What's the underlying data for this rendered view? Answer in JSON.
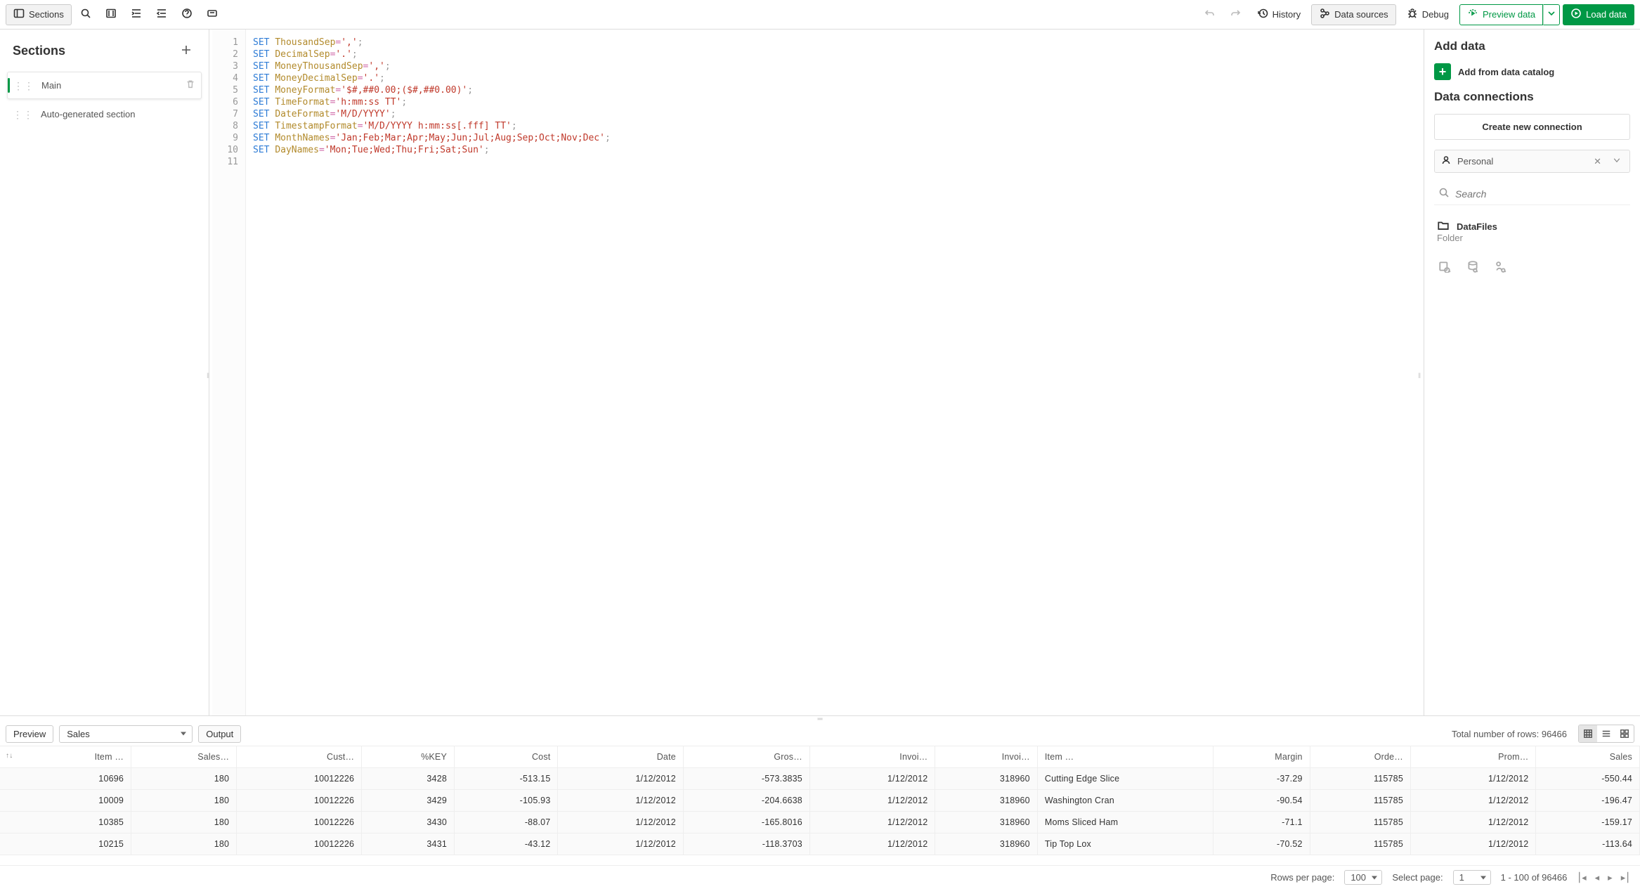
{
  "toolbar": {
    "sections": "Sections",
    "history": "History",
    "dataSources": "Data sources",
    "debug": "Debug",
    "preview": "Preview data",
    "load": "Load data"
  },
  "sidebar": {
    "title": "Sections",
    "items": [
      {
        "label": "Main"
      },
      {
        "label": "Auto-generated section"
      }
    ]
  },
  "editor": {
    "lines": [
      {
        "kw": "SET",
        "var": "ThousandSep",
        "val": "','"
      },
      {
        "kw": "SET",
        "var": "DecimalSep",
        "val": "'.'"
      },
      {
        "kw": "SET",
        "var": "MoneyThousandSep",
        "val": "','"
      },
      {
        "kw": "SET",
        "var": "MoneyDecimalSep",
        "val": "'.'"
      },
      {
        "kw": "SET",
        "var": "MoneyFormat",
        "val": "'$#,##0.00;($#,##0.00)'"
      },
      {
        "kw": "SET",
        "var": "TimeFormat",
        "val": "'h:mm:ss TT'"
      },
      {
        "kw": "SET",
        "var": "DateFormat",
        "val": "'M/D/YYYY'"
      },
      {
        "kw": "SET",
        "var": "TimestampFormat",
        "val": "'M/D/YYYY h:mm:ss[.fff] TT'"
      },
      {
        "kw": "SET",
        "var": "MonthNames",
        "val": "'Jan;Feb;Mar;Apr;May;Jun;Jul;Aug;Sep;Oct;Nov;Dec'"
      },
      {
        "kw": "SET",
        "var": "DayNames",
        "val": "'Mon;Tue;Wed;Thu;Fri;Sat;Sun'"
      }
    ]
  },
  "rightPanel": {
    "addDataTitle": "Add data",
    "catalogLabel": "Add from data catalog",
    "connectionsTitle": "Data connections",
    "createConn": "Create new connection",
    "spaceLabel": "Personal",
    "searchPlaceholder": "Search",
    "folderName": "DataFiles",
    "folderType": "Folder"
  },
  "preview": {
    "previewTab": "Preview",
    "outputTab": "Output",
    "tableSelected": "Sales",
    "totalRows": "Total number of rows: 96466",
    "columns": [
      "Item …",
      "Sales…",
      "Cust…",
      "%KEY",
      "Cost",
      "Date",
      "Gros…",
      "Invoi…",
      "Invoi…",
      "Item …",
      "Margin",
      "Orde…",
      "Prom…",
      "Sales"
    ],
    "rows": [
      [
        "10696",
        "180",
        "10012226",
        "3428",
        "-513.15",
        "1/12/2012",
        "-573.3835",
        "1/12/2012",
        "318960",
        "Cutting Edge Slice",
        "-37.29",
        "115785",
        "1/12/2012",
        "-550.44"
      ],
      [
        "10009",
        "180",
        "10012226",
        "3429",
        "-105.93",
        "1/12/2012",
        "-204.6638",
        "1/12/2012",
        "318960",
        "Washington Cran",
        "-90.54",
        "115785",
        "1/12/2012",
        "-196.47"
      ],
      [
        "10385",
        "180",
        "10012226",
        "3430",
        "-88.07",
        "1/12/2012",
        "-165.8016",
        "1/12/2012",
        "318960",
        "Moms Sliced Ham",
        "-71.1",
        "115785",
        "1/12/2012",
        "-159.17"
      ],
      [
        "10215",
        "180",
        "10012226",
        "3431",
        "-43.12",
        "1/12/2012",
        "-118.3703",
        "1/12/2012",
        "318960",
        "Tip Top Lox",
        "-70.52",
        "115785",
        "1/12/2012",
        "-113.64"
      ]
    ]
  },
  "pager": {
    "rowsPerPageLabel": "Rows per page:",
    "rowsPerPage": "100",
    "selectPageLabel": "Select page:",
    "page": "1",
    "range": "1 - 100 of 96466"
  }
}
